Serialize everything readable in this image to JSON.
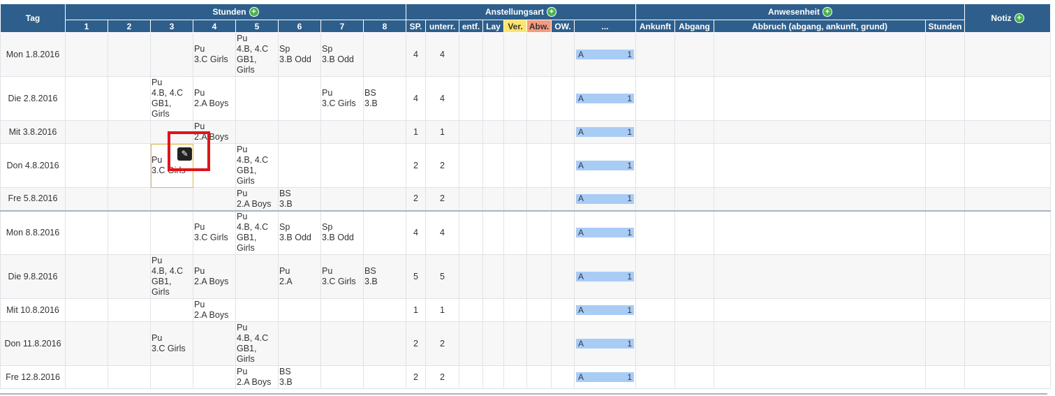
{
  "header": {
    "tag": "Tag",
    "stunden": "Stunden",
    "anstellungsart": "Anstellungsart",
    "anwesenheit": "Anwesenheit",
    "notiz": "Notiz",
    "plus": "+",
    "periods": [
      "1",
      "2",
      "3",
      "4",
      "5",
      "6",
      "7",
      "8"
    ],
    "anst_cols": [
      "SP.",
      "unterr.",
      "entf.",
      "Lay",
      "Ver.",
      "Abw.",
      "OW.",
      "..."
    ],
    "anw_cols": [
      "Ankunft",
      "Abgang",
      "Abbruch (abgang, ankunft, grund)",
      "Stunden"
    ]
  },
  "rows": [
    {
      "day": "Mon 1.8.2016",
      "l": [
        "",
        "",
        "",
        "Pu\n3.C Girls",
        "Pu\n4.B, 4.C\nGB1,\nGirls",
        "Sp\n3.B Odd",
        "Sp\n3.B Odd",
        ""
      ],
      "sp": "4",
      "unterr": "4",
      "a": "A",
      "n": "1"
    },
    {
      "day": "Die 2.8.2016",
      "l": [
        "",
        "",
        "Pu\n4.B, 4.C\nGB1,\nGirls",
        "Pu\n2.A Boys",
        "",
        "",
        "Pu\n3.C Girls",
        "BS\n3.B"
      ],
      "sp": "4",
      "unterr": "4",
      "a": "A",
      "n": "1"
    },
    {
      "day": "Mit 3.8.2016",
      "l": [
        "",
        "",
        "",
        "Pu\n2.A Boys",
        "",
        "",
        "",
        ""
      ],
      "sp": "1",
      "unterr": "1",
      "a": "A",
      "n": "1"
    },
    {
      "day": "Don 4.8.2016",
      "l": [
        "",
        "",
        "Pu\n3.C Girls",
        "",
        "Pu\n4.B, 4.C\nGB1,\nGirls",
        "",
        "",
        ""
      ],
      "sp": "2",
      "unterr": "2",
      "a": "A",
      "n": "1"
    },
    {
      "day": "Fre 5.8.2016",
      "l": [
        "",
        "",
        "",
        "",
        "Pu\n2.A Boys",
        "BS\n3.B",
        "",
        ""
      ],
      "sp": "2",
      "unterr": "2",
      "a": "A",
      "n": "1"
    },
    {
      "day": "Mon 8.8.2016",
      "l": [
        "",
        "",
        "",
        "Pu\n3.C Girls",
        "Pu\n4.B, 4.C\nGB1,\nGirls",
        "Sp\n3.B Odd",
        "Sp\n3.B Odd",
        ""
      ],
      "sp": "4",
      "unterr": "4",
      "a": "A",
      "n": "1"
    },
    {
      "day": "Die 9.8.2016",
      "l": [
        "",
        "",
        "Pu\n4.B, 4.C\nGB1,\nGirls",
        "Pu\n2.A Boys",
        "",
        "Pu\n2.A",
        "Pu\n3.C Girls",
        "BS\n3.B"
      ],
      "sp": "5",
      "unterr": "5",
      "a": "A",
      "n": "1"
    },
    {
      "day": "Mit 10.8.2016",
      "l": [
        "",
        "",
        "",
        "Pu\n2.A Boys",
        "",
        "",
        "",
        ""
      ],
      "sp": "1",
      "unterr": "1",
      "a": "A",
      "n": "1"
    },
    {
      "day": "Don 11.8.2016",
      "l": [
        "",
        "",
        "Pu\n3.C Girls",
        "",
        "Pu\n4.B, 4.C\nGB1,\nGirls",
        "",
        "",
        ""
      ],
      "sp": "2",
      "unterr": "2",
      "a": "A",
      "n": "1"
    },
    {
      "day": "Fre 12.8.2016",
      "l": [
        "",
        "",
        "",
        "",
        "Pu\n2.A Boys",
        "BS\n3.B",
        "",
        ""
      ],
      "sp": "2",
      "unterr": "2",
      "a": "A",
      "n": "1"
    }
  ],
  "colors": {
    "header": "#2e5f8c",
    "ver": "#ffe46b",
    "abw": "#f49b80",
    "abar": "#a9ccf5",
    "highlight": "#e0141a"
  },
  "icons": {
    "edit": "pencil-icon",
    "add": "plus-icon"
  }
}
